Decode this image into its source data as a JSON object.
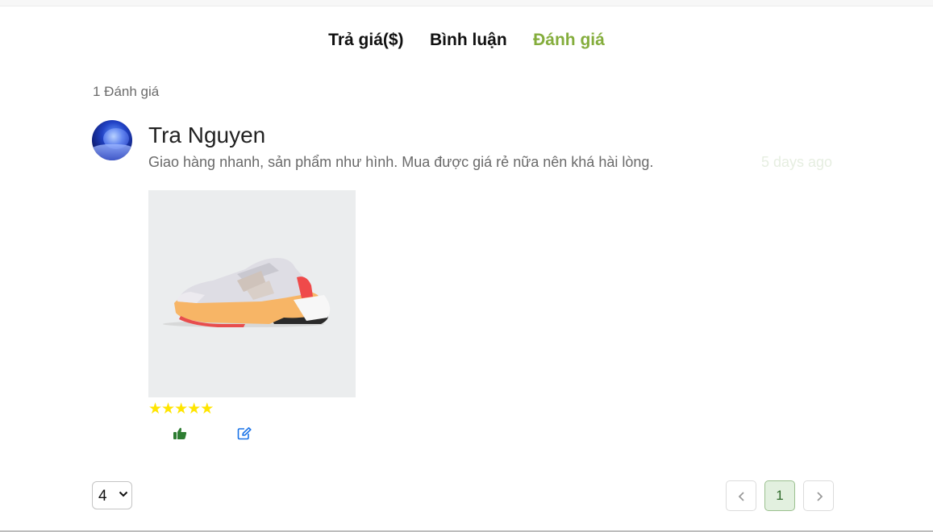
{
  "tabs": [
    {
      "label": "Trả giá($)"
    },
    {
      "label": "Bình luận"
    },
    {
      "label": "Đánh giá"
    }
  ],
  "reviews": {
    "count_label": "1 Đánh giá",
    "items": [
      {
        "author": "Tra Nguyen",
        "comment": "Giao hàng nhanh, sản phẩm như hình. Mua được giá rẻ nữa nên khá hài lòng.",
        "time": "5 days ago",
        "rating": 5,
        "icons": {
          "avatar": "user-avatar-image",
          "like": "thumbs-up-icon",
          "edit": "edit-icon",
          "star": "star-icon",
          "photo": "shoe-product-photo"
        }
      }
    ]
  },
  "pagination": {
    "page_size_value": "4",
    "current_page": "1",
    "icons": {
      "prev": "chevron-left-icon",
      "next": "chevron-right-icon",
      "dropdown": "chevron-down-icon"
    }
  },
  "colors": {
    "active_tab": "#84ad3c",
    "star": "#ffe500",
    "like_icon": "#2e7d32",
    "edit_icon": "#1a73e8",
    "current_page_bg": "#e2f0df"
  }
}
